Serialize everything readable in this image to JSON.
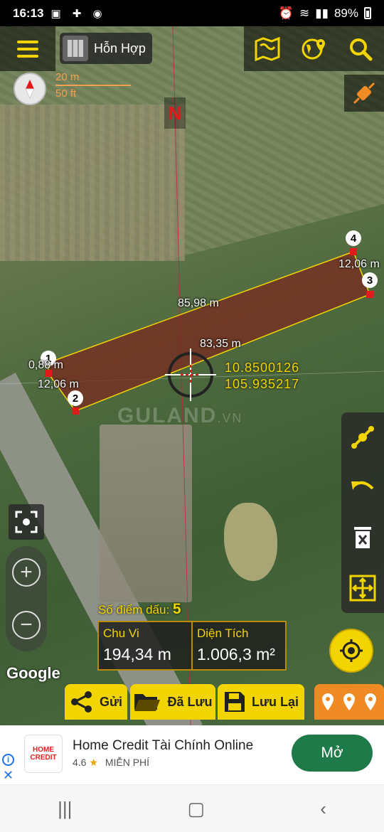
{
  "status_bar": {
    "time": "16:13",
    "battery": "89%",
    "icons": [
      "image-icon",
      "contacts-icon",
      "messenger-icon",
      "alarm-icon",
      "wifi-icon",
      "signal-icon",
      "signal-icon"
    ]
  },
  "toolbar": {
    "map_type_label": "Hỗn Hợp",
    "icons": [
      "menu-icon",
      "map-layers-icon",
      "earth-location-icon",
      "search-icon",
      "gps-tool-icon"
    ]
  },
  "scale": {
    "metric": "20 m",
    "imperial": "50 ft"
  },
  "north_label": "N",
  "plot": {
    "segments": {
      "top_long": "85,98 m",
      "bottom_long": "83,35 m",
      "right_short": "12,06 m",
      "left_short": "12,06 m",
      "left_tiny": "0,88 m"
    },
    "points": [
      "1",
      "2",
      "3",
      "4"
    ]
  },
  "crosshair": {
    "lat": "10.8500126",
    "lng": "105.935217"
  },
  "watermark": {
    "brand": "GULAND",
    "suffix": ".VN"
  },
  "summary": {
    "point_count_label": "Số điểm dấu:",
    "point_count": "5",
    "perimeter_label": "Chu Vi",
    "perimeter_value": "194,34 m",
    "area_label": "Diện Tích",
    "area_value": "1.006,3 m²"
  },
  "google_label": "Google",
  "actions": {
    "send": "Gửi",
    "saved": "Đã Lưu",
    "save": "Lưu Lại"
  },
  "ad": {
    "logo_line1": "HOME",
    "logo_line2": "CREDIT",
    "title": "Home Credit Tài Chính Online",
    "rating": "4.6",
    "price": "MIỄN PHÍ",
    "cta": "Mở"
  },
  "colors": {
    "accent": "#f2d500",
    "plot_fill": "#7a2a1f",
    "plot_stroke": "#f2d500",
    "marker": "#e31a1a",
    "action_orange": "#f08a24",
    "ad_button": "#1f7a4a"
  }
}
